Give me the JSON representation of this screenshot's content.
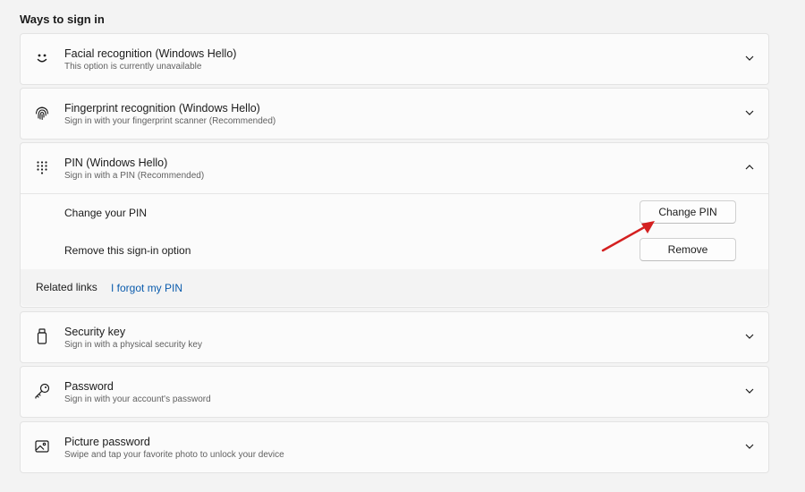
{
  "section_title": "Ways to sign in",
  "options": {
    "facial": {
      "title": "Facial recognition (Windows Hello)",
      "subtitle": "This option is currently unavailable",
      "icon": "smiley-face-icon"
    },
    "fingerprint": {
      "title": "Fingerprint recognition (Windows Hello)",
      "subtitle": "Sign in with your fingerprint scanner (Recommended)",
      "icon": "fingerprint-icon"
    },
    "pin": {
      "title": "PIN (Windows Hello)",
      "subtitle": "Sign in with a PIN (Recommended)",
      "icon": "keypad-icon",
      "expanded": true,
      "change_label": "Change your PIN",
      "change_button": "Change PIN",
      "remove_label": "Remove this sign-in option",
      "remove_button": "Remove",
      "related_label": "Related links",
      "related_link": "I forgot my PIN"
    },
    "security_key": {
      "title": "Security key",
      "subtitle": "Sign in with a physical security key",
      "icon": "usb-key-icon"
    },
    "password": {
      "title": "Password",
      "subtitle": "Sign in with your account's password",
      "icon": "key-icon"
    },
    "picture_password": {
      "title": "Picture password",
      "subtitle": "Swipe and tap your favorite photo to unlock your device",
      "icon": "picture-icon"
    }
  },
  "colors": {
    "link": "#0b5cad",
    "annotation_arrow": "#d42020"
  }
}
